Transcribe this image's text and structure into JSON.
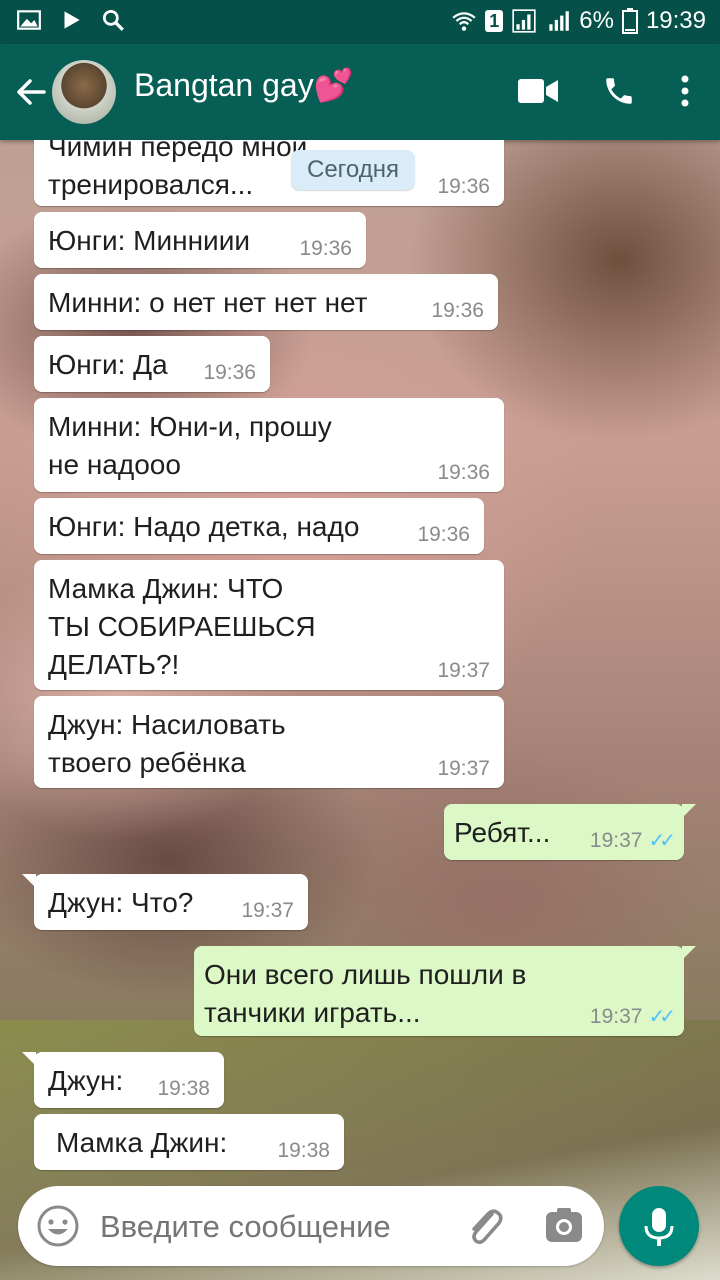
{
  "status_bar": {
    "battery_percent": "6%",
    "time": "19:39",
    "sim_badge": "1",
    "icons": [
      "gallery-icon",
      "play-icon",
      "search-icon",
      "wifi-icon",
      "signal-icon",
      "signal-icon",
      "battery-icon"
    ]
  },
  "header": {
    "title": "Bangtan gay💕",
    "icons": [
      "back-arrow-icon",
      "video-call-icon",
      "phone-icon",
      "more-vert-icon"
    ]
  },
  "chat": {
    "date_chip": "Сегодня",
    "messages": [
      {
        "dir": "in",
        "line1": "Чимин передо мной",
        "line2": "тренировался...",
        "time": "19:36"
      },
      {
        "dir": "in",
        "text": "Юнги: Минниии",
        "time": "19:36"
      },
      {
        "dir": "in",
        "text": "Минни: о нет нет нет нет",
        "time": "19:36"
      },
      {
        "dir": "in",
        "text": "Юнги: Да",
        "time": "19:36"
      },
      {
        "dir": "in",
        "line1": "Минни: Юни-и, прошу",
        "line2": "не надооо",
        "time": "19:36"
      },
      {
        "dir": "in",
        "text": "Юнги: Надо детка, надо",
        "time": "19:36"
      },
      {
        "dir": "in",
        "line1": "Мамка Джин: ЧТО",
        "line2": "ТЫ СОБИРАЕШЬСЯ",
        "line3": "ДЕЛАТЬ?!",
        "time": "19:37"
      },
      {
        "dir": "in",
        "line1": "Джун: Насиловать",
        "line2": "твоего ребёнка",
        "time": "19:37"
      },
      {
        "dir": "out",
        "text": "Ребят...",
        "time": "19:37"
      },
      {
        "dir": "in",
        "text": "Джун: Что?",
        "time": "19:37"
      },
      {
        "dir": "out",
        "line1": "Они всего лишь пошли в",
        "line2": "танчики играть...",
        "time": "19:37"
      },
      {
        "dir": "in",
        "text": "Джун:",
        "time": "19:38"
      },
      {
        "dir": "in",
        "text": "Мамка Джин:",
        "time": "19:38"
      }
    ]
  },
  "composer": {
    "placeholder": "Введите сообщение",
    "icons": [
      "emoji-icon",
      "attach-icon",
      "camera-icon",
      "mic-icon"
    ]
  },
  "colors": {
    "app_bar": "#075e54",
    "status_bar": "#055048",
    "outgoing_bubble": "#dcf8c6",
    "read_ticks": "#4fc3f7",
    "mic_button": "#00897b"
  }
}
